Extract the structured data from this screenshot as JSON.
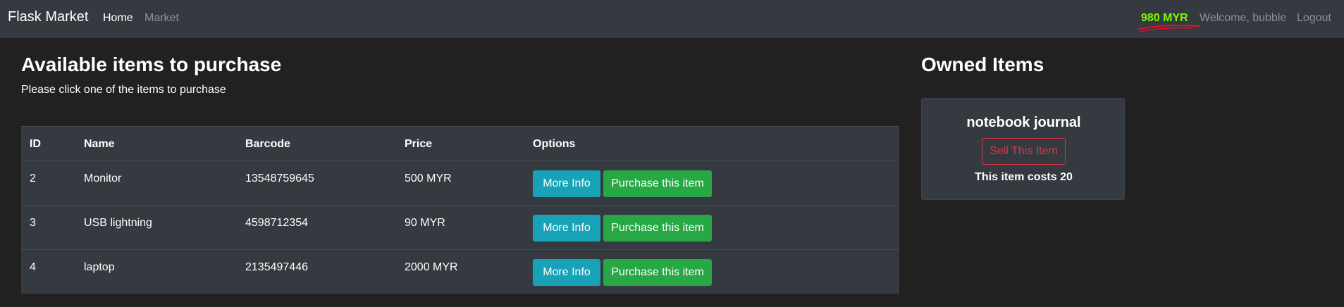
{
  "navbar": {
    "brand": "Flask Market",
    "links": [
      "Home",
      "Market"
    ],
    "budget": "980 MYR",
    "welcome": "Welcome, bubble",
    "logout": "Logout"
  },
  "market": {
    "heading": "Available items to purchase",
    "subtitle": "Please click one of the items to purchase",
    "columns": [
      "ID",
      "Name",
      "Barcode",
      "Price",
      "Options"
    ],
    "rows": [
      {
        "id": "2",
        "name": "Monitor",
        "barcode": "13548759645",
        "price": "500 MYR"
      },
      {
        "id": "3",
        "name": "USB lightning",
        "barcode": "4598712354",
        "price": "90 MYR"
      },
      {
        "id": "4",
        "name": "laptop",
        "barcode": "2135497446",
        "price": "2000 MYR"
      }
    ],
    "info_button": "More Info",
    "purchase_button": "Purchase this item"
  },
  "owned": {
    "heading": "Owned Items",
    "items": [
      {
        "name": "notebook journal",
        "sell_label": "Sell This Item",
        "cost_text": "This item costs 20"
      }
    ]
  },
  "colors": {
    "background": "#212121",
    "navbar": "#343a40",
    "budget": "#7cfc00",
    "info": "#17a2b8",
    "success": "#28a745",
    "danger": "#dc3545"
  }
}
